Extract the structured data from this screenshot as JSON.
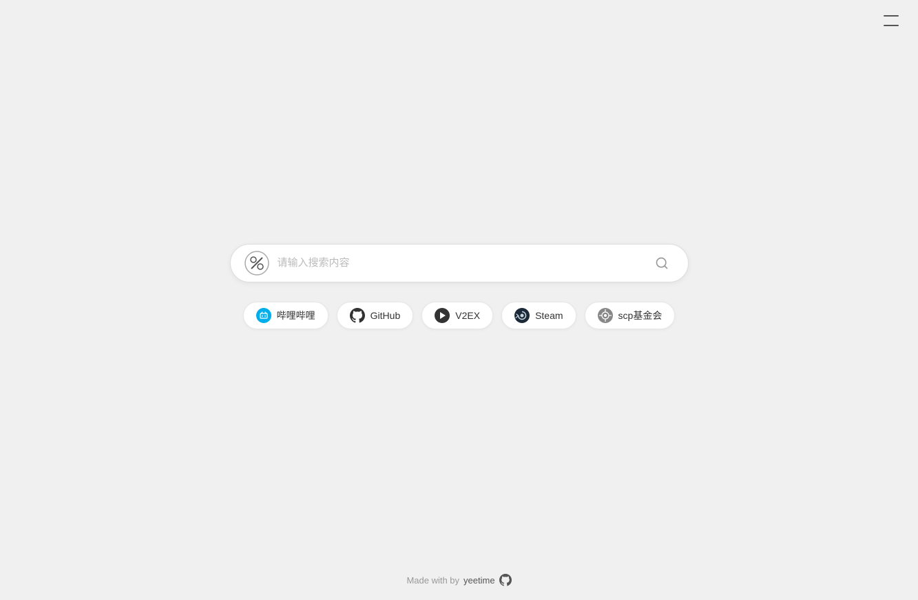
{
  "header": {
    "menu_label": "menu"
  },
  "search": {
    "placeholder": "请输入搜索内容"
  },
  "shortcuts": [
    {
      "id": "bilibili",
      "label": "哔哩哔哩",
      "icon_type": "bili",
      "url": "https://www.bilibili.com"
    },
    {
      "id": "github",
      "label": "GitHub",
      "icon_type": "github",
      "url": "https://github.com"
    },
    {
      "id": "v2ex",
      "label": "V2EX",
      "icon_type": "v2ex",
      "url": "https://v2ex.com"
    },
    {
      "id": "steam",
      "label": "Steam",
      "icon_type": "steam",
      "url": "https://store.steampowered.com"
    },
    {
      "id": "scp",
      "label": "scp基金会",
      "icon_type": "scp",
      "url": "http://scp-wiki-cn.wikidot.com"
    }
  ],
  "footer": {
    "prefix": "Made with by",
    "brand": "yeetime"
  }
}
